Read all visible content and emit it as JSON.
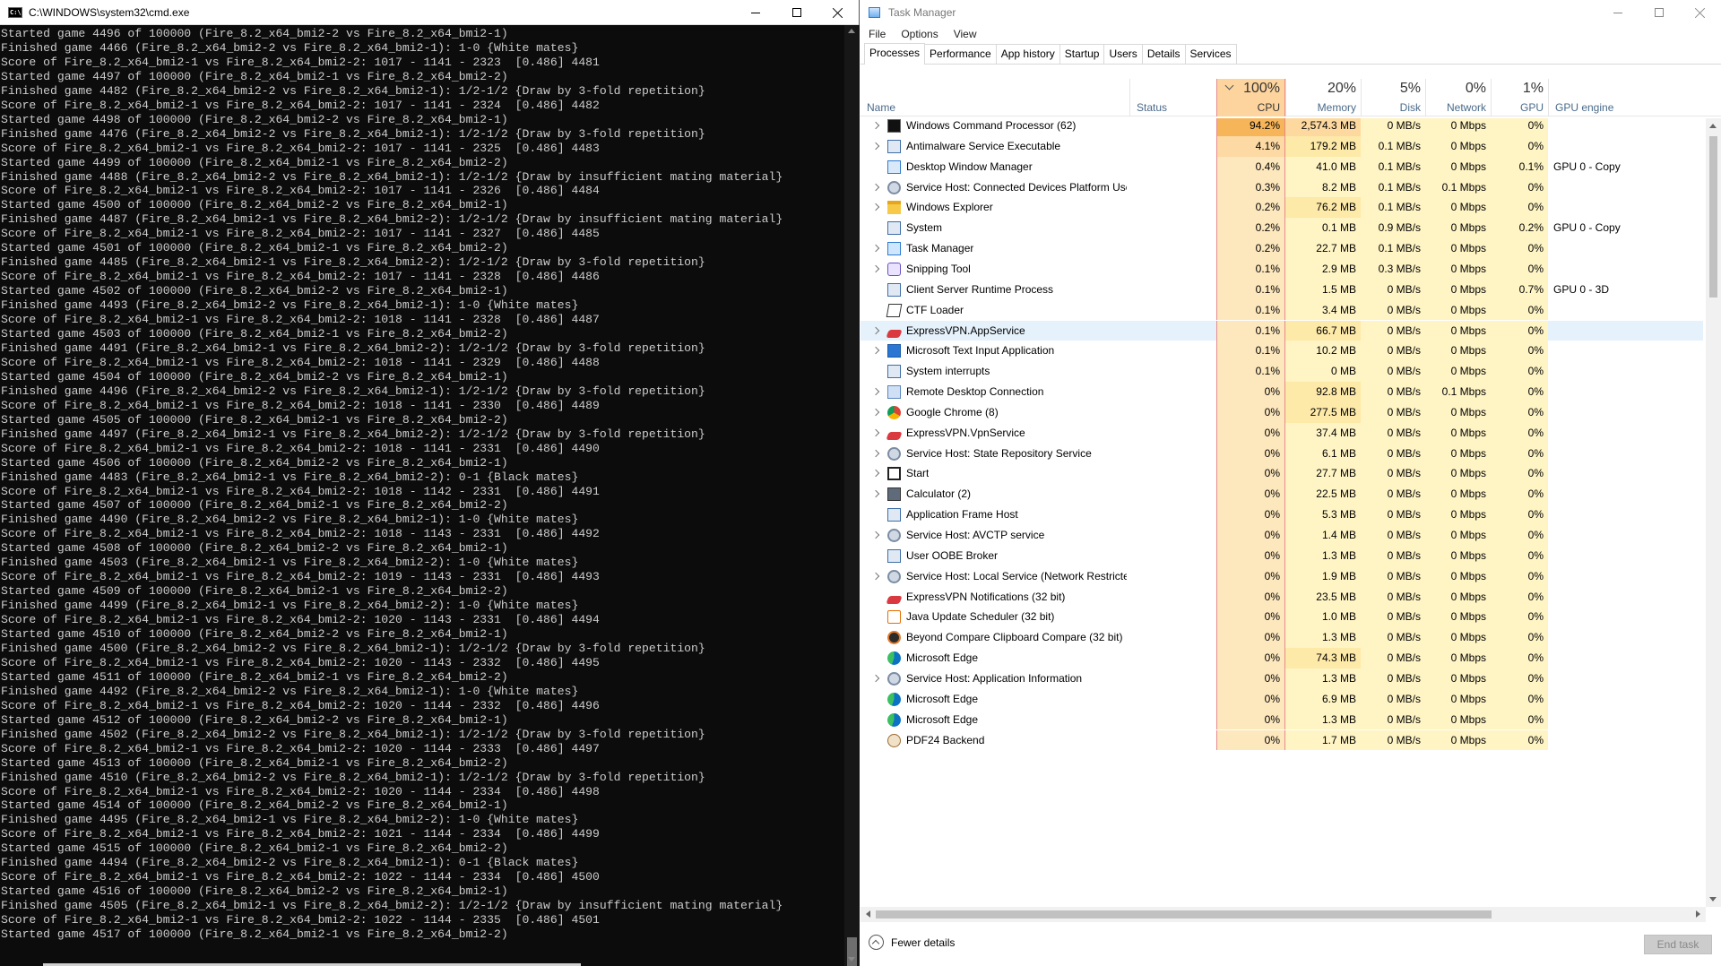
{
  "cmd": {
    "title": "C:\\WINDOWS\\system32\\cmd.exe",
    "lines": [
      "Started game 4496 of 100000 (Fire_8.2_x64_bmi2-2 vs Fire_8.2_x64_bmi2-1)",
      "Finished game 4466 (Fire_8.2_x64_bmi2-2 vs Fire_8.2_x64_bmi2-1): 1-0 {White mates}",
      "Score of Fire_8.2_x64_bmi2-1 vs Fire_8.2_x64_bmi2-2: 1017 - 1141 - 2323  [0.486] 4481",
      "Started game 4497 of 100000 (Fire_8.2_x64_bmi2-1 vs Fire_8.2_x64_bmi2-2)",
      "Finished game 4482 (Fire_8.2_x64_bmi2-2 vs Fire_8.2_x64_bmi2-1): 1/2-1/2 {Draw by 3-fold repetition}",
      "Score of Fire_8.2_x64_bmi2-1 vs Fire_8.2_x64_bmi2-2: 1017 - 1141 - 2324  [0.486] 4482",
      "Started game 4498 of 100000 (Fire_8.2_x64_bmi2-2 vs Fire_8.2_x64_bmi2-1)",
      "Finished game 4476 (Fire_8.2_x64_bmi2-2 vs Fire_8.2_x64_bmi2-1): 1/2-1/2 {Draw by 3-fold repetition}",
      "Score of Fire_8.2_x64_bmi2-1 vs Fire_8.2_x64_bmi2-2: 1017 - 1141 - 2325  [0.486] 4483",
      "Started game 4499 of 100000 (Fire_8.2_x64_bmi2-1 vs Fire_8.2_x64_bmi2-2)",
      "Finished game 4488 (Fire_8.2_x64_bmi2-2 vs Fire_8.2_x64_bmi2-1): 1/2-1/2 {Draw by insufficient mating material}",
      "Score of Fire_8.2_x64_bmi2-1 vs Fire_8.2_x64_bmi2-2: 1017 - 1141 - 2326  [0.486] 4484",
      "Started game 4500 of 100000 (Fire_8.2_x64_bmi2-2 vs Fire_8.2_x64_bmi2-1)",
      "Finished game 4487 (Fire_8.2_x64_bmi2-1 vs Fire_8.2_x64_bmi2-2): 1/2-1/2 {Draw by insufficient mating material}",
      "Score of Fire_8.2_x64_bmi2-1 vs Fire_8.2_x64_bmi2-2: 1017 - 1141 - 2327  [0.486] 4485",
      "Started game 4501 of 100000 (Fire_8.2_x64_bmi2-1 vs Fire_8.2_x64_bmi2-2)",
      "Finished game 4485 (Fire_8.2_x64_bmi2-1 vs Fire_8.2_x64_bmi2-2): 1/2-1/2 {Draw by 3-fold repetition}",
      "Score of Fire_8.2_x64_bmi2-1 vs Fire_8.2_x64_bmi2-2: 1017 - 1141 - 2328  [0.486] 4486",
      "Started game 4502 of 100000 (Fire_8.2_x64_bmi2-2 vs Fire_8.2_x64_bmi2-1)",
      "Finished game 4493 (Fire_8.2_x64_bmi2-2 vs Fire_8.2_x64_bmi2-1): 1-0 {White mates}",
      "Score of Fire_8.2_x64_bmi2-1 vs Fire_8.2_x64_bmi2-2: 1018 - 1141 - 2328  [0.486] 4487",
      "Started game 4503 of 100000 (Fire_8.2_x64_bmi2-1 vs Fire_8.2_x64_bmi2-2)",
      "Finished game 4491 (Fire_8.2_x64_bmi2-1 vs Fire_8.2_x64_bmi2-2): 1/2-1/2 {Draw by 3-fold repetition}",
      "Score of Fire_8.2_x64_bmi2-1 vs Fire_8.2_x64_bmi2-2: 1018 - 1141 - 2329  [0.486] 4488",
      "Started game 4504 of 100000 (Fire_8.2_x64_bmi2-2 vs Fire_8.2_x64_bmi2-1)",
      "Finished game 4496 (Fire_8.2_x64_bmi2-2 vs Fire_8.2_x64_bmi2-1): 1/2-1/2 {Draw by 3-fold repetition}",
      "Score of Fire_8.2_x64_bmi2-1 vs Fire_8.2_x64_bmi2-2: 1018 - 1141 - 2330  [0.486] 4489",
      "Started game 4505 of 100000 (Fire_8.2_x64_bmi2-1 vs Fire_8.2_x64_bmi2-2)",
      "Finished game 4497 (Fire_8.2_x64_bmi2-1 vs Fire_8.2_x64_bmi2-2): 1/2-1/2 {Draw by 3-fold repetition}",
      "Score of Fire_8.2_x64_bmi2-1 vs Fire_8.2_x64_bmi2-2: 1018 - 1141 - 2331  [0.486] 4490",
      "Started game 4506 of 100000 (Fire_8.2_x64_bmi2-2 vs Fire_8.2_x64_bmi2-1)",
      "Finished game 4483 (Fire_8.2_x64_bmi2-1 vs Fire_8.2_x64_bmi2-2): 0-1 {Black mates}",
      "Score of Fire_8.2_x64_bmi2-1 vs Fire_8.2_x64_bmi2-2: 1018 - 1142 - 2331  [0.486] 4491",
      "Started game 4507 of 100000 (Fire_8.2_x64_bmi2-1 vs Fire_8.2_x64_bmi2-2)",
      "Finished game 4490 (Fire_8.2_x64_bmi2-2 vs Fire_8.2_x64_bmi2-1): 1-0 {White mates}",
      "Score of Fire_8.2_x64_bmi2-1 vs Fire_8.2_x64_bmi2-2: 1018 - 1143 - 2331  [0.486] 4492",
      "Started game 4508 of 100000 (Fire_8.2_x64_bmi2-2 vs Fire_8.2_x64_bmi2-1)",
      "Finished game 4503 (Fire_8.2_x64_bmi2-1 vs Fire_8.2_x64_bmi2-2): 1-0 {White mates}",
      "Score of Fire_8.2_x64_bmi2-1 vs Fire_8.2_x64_bmi2-2: 1019 - 1143 - 2331  [0.486] 4493",
      "Started game 4509 of 100000 (Fire_8.2_x64_bmi2-1 vs Fire_8.2_x64_bmi2-2)",
      "Finished game 4499 (Fire_8.2_x64_bmi2-1 vs Fire_8.2_x64_bmi2-2): 1-0 {White mates}",
      "Score of Fire_8.2_x64_bmi2-1 vs Fire_8.2_x64_bmi2-2: 1020 - 1143 - 2331  [0.486] 4494",
      "Started game 4510 of 100000 (Fire_8.2_x64_bmi2-2 vs Fire_8.2_x64_bmi2-1)",
      "Finished game 4500 (Fire_8.2_x64_bmi2-2 vs Fire_8.2_x64_bmi2-1): 1/2-1/2 {Draw by 3-fold repetition}",
      "Score of Fire_8.2_x64_bmi2-1 vs Fire_8.2_x64_bmi2-2: 1020 - 1143 - 2332  [0.486] 4495",
      "Started game 4511 of 100000 (Fire_8.2_x64_bmi2-1 vs Fire_8.2_x64_bmi2-2)",
      "Finished game 4492 (Fire_8.2_x64_bmi2-2 vs Fire_8.2_x64_bmi2-1): 1-0 {White mates}",
      "Score of Fire_8.2_x64_bmi2-1 vs Fire_8.2_x64_bmi2-2: 1020 - 1144 - 2332  [0.486] 4496",
      "Started game 4512 of 100000 (Fire_8.2_x64_bmi2-2 vs Fire_8.2_x64_bmi2-1)",
      "Finished game 4502 (Fire_8.2_x64_bmi2-2 vs Fire_8.2_x64_bmi2-1): 1/2-1/2 {Draw by 3-fold repetition}",
      "Score of Fire_8.2_x64_bmi2-1 vs Fire_8.2_x64_bmi2-2: 1020 - 1144 - 2333  [0.486] 4497",
      "Started game 4513 of 100000 (Fire_8.2_x64_bmi2-1 vs Fire_8.2_x64_bmi2-2)",
      "Finished game 4510 (Fire_8.2_x64_bmi2-2 vs Fire_8.2_x64_bmi2-1): 1/2-1/2 {Draw by 3-fold repetition}",
      "Score of Fire_8.2_x64_bmi2-1 vs Fire_8.2_x64_bmi2-2: 1020 - 1144 - 2334  [0.486] 4498",
      "Started game 4514 of 100000 (Fire_8.2_x64_bmi2-2 vs Fire_8.2_x64_bmi2-1)",
      "Finished game 4495 (Fire_8.2_x64_bmi2-1 vs Fire_8.2_x64_bmi2-2): 1-0 {White mates}",
      "Score of Fire_8.2_x64_bmi2-1 vs Fire_8.2_x64_bmi2-2: 1021 - 1144 - 2334  [0.486] 4499",
      "Started game 4515 of 100000 (Fire_8.2_x64_bmi2-1 vs Fire_8.2_x64_bmi2-2)",
      "Finished game 4494 (Fire_8.2_x64_bmi2-2 vs Fire_8.2_x64_bmi2-1): 0-1 {Black mates}",
      "Score of Fire_8.2_x64_bmi2-1 vs Fire_8.2_x64_bmi2-2: 1022 - 1144 - 2334  [0.486] 4500",
      "Started game 4516 of 100000 (Fire_8.2_x64_bmi2-2 vs Fire_8.2_x64_bmi2-1)",
      "Finished game 4505 (Fire_8.2_x64_bmi2-1 vs Fire_8.2_x64_bmi2-2): 1/2-1/2 {Draw by insufficient mating material}",
      "Score of Fire_8.2_x64_bmi2-1 vs Fire_8.2_x64_bmi2-2: 1022 - 1144 - 2335  [0.486] 4501",
      "Started game 4517 of 100000 (Fire_8.2_x64_bmi2-1 vs Fire_8.2_x64_bmi2-2)"
    ]
  },
  "taskmanager": {
    "title": "Task Manager",
    "menu": [
      "File",
      "Options",
      "View"
    ],
    "tabs": [
      "Processes",
      "Performance",
      "App history",
      "Startup",
      "Users",
      "Details",
      "Services"
    ],
    "active_tab": "Processes",
    "columns": {
      "name": "Name",
      "status": "Status",
      "cpu": {
        "pct": "100%",
        "label": "CPU"
      },
      "memory": {
        "pct": "20%",
        "label": "Memory"
      },
      "disk": {
        "pct": "5%",
        "label": "Disk"
      },
      "network": {
        "pct": "0%",
        "label": "Network"
      },
      "gpu": {
        "pct": "1%",
        "label": "GPU"
      },
      "gpu_engine": "GPU engine"
    },
    "processes": [
      {
        "name": "Windows Command Processor (62)",
        "icon": "cmd-icon",
        "expand": true,
        "cpu": "94.2%",
        "mem": "2,574.3 MB",
        "disk": "0 MB/s",
        "net": "0 Mbps",
        "gpu": "0%",
        "engine": ""
      },
      {
        "name": "Antimalware Service Executable",
        "icon": "shield-icon",
        "expand": true,
        "cpu": "4.1%",
        "mem": "179.2 MB",
        "disk": "0.1 MB/s",
        "net": "0 Mbps",
        "gpu": "0%",
        "engine": ""
      },
      {
        "name": "Desktop Window Manager",
        "icon": "dwm-icon",
        "expand": false,
        "cpu": "0.4%",
        "mem": "41.0 MB",
        "disk": "0.1 MB/s",
        "net": "0 Mbps",
        "gpu": "0.1%",
        "engine": "GPU 0 - Copy"
      },
      {
        "name": "Service Host: Connected Devices Platform User S...",
        "icon": "gear-icon",
        "expand": true,
        "cpu": "0.3%",
        "mem": "8.2 MB",
        "disk": "0.1 MB/s",
        "net": "0.1 Mbps",
        "gpu": "0%",
        "engine": ""
      },
      {
        "name": "Windows Explorer",
        "icon": "folder-icon",
        "expand": true,
        "cpu": "0.2%",
        "mem": "76.2 MB",
        "disk": "0.1 MB/s",
        "net": "0 Mbps",
        "gpu": "0%",
        "engine": ""
      },
      {
        "name": "System",
        "icon": "system-icon",
        "expand": false,
        "cpu": "0.2%",
        "mem": "0.1 MB",
        "disk": "0.9 MB/s",
        "net": "0 Mbps",
        "gpu": "0.2%",
        "engine": "GPU 0 - Copy"
      },
      {
        "name": "Task Manager",
        "icon": "taskmanager-icon",
        "expand": true,
        "cpu": "0.2%",
        "mem": "22.7 MB",
        "disk": "0.1 MB/s",
        "net": "0 Mbps",
        "gpu": "0%",
        "engine": ""
      },
      {
        "name": "Snipping Tool",
        "icon": "snipping-icon",
        "expand": true,
        "cpu": "0.1%",
        "mem": "2.9 MB",
        "disk": "0.3 MB/s",
        "net": "0 Mbps",
        "gpu": "0%",
        "engine": ""
      },
      {
        "name": "Client Server Runtime Process",
        "icon": "system-icon",
        "expand": false,
        "cpu": "0.1%",
        "mem": "1.5 MB",
        "disk": "0 MB/s",
        "net": "0 Mbps",
        "gpu": "0.7%",
        "engine": "GPU 0 - 3D"
      },
      {
        "name": "CTF Loader",
        "icon": "ctf-icon",
        "expand": false,
        "cpu": "0.1%",
        "mem": "3.4 MB",
        "disk": "0 MB/s",
        "net": "0 Mbps",
        "gpu": "0%",
        "engine": ""
      },
      {
        "name": "ExpressVPN.AppService",
        "icon": "expressvpn-icon",
        "expand": true,
        "cpu": "0.1%",
        "mem": "66.7 MB",
        "disk": "0 MB/s",
        "net": "0 Mbps",
        "gpu": "0%",
        "engine": "",
        "selected": true
      },
      {
        "name": "Microsoft Text Input Application",
        "icon": "text-input-icon",
        "expand": true,
        "cpu": "0.1%",
        "mem": "10.2 MB",
        "disk": "0 MB/s",
        "net": "0 Mbps",
        "gpu": "0%",
        "engine": ""
      },
      {
        "name": "System interrupts",
        "icon": "system-icon",
        "expand": false,
        "cpu": "0.1%",
        "mem": "0 MB",
        "disk": "0 MB/s",
        "net": "0 Mbps",
        "gpu": "0%",
        "engine": ""
      },
      {
        "name": "Remote Desktop Connection",
        "icon": "remote-desktop-icon",
        "expand": true,
        "cpu": "0%",
        "mem": "92.8 MB",
        "disk": "0 MB/s",
        "net": "0.1 Mbps",
        "gpu": "0%",
        "engine": ""
      },
      {
        "name": "Google Chrome (8)",
        "icon": "chrome-icon",
        "expand": true,
        "cpu": "0%",
        "mem": "277.5 MB",
        "disk": "0 MB/s",
        "net": "0 Mbps",
        "gpu": "0%",
        "engine": ""
      },
      {
        "name": "ExpressVPN.VpnService",
        "icon": "expressvpn-icon",
        "expand": true,
        "cpu": "0%",
        "mem": "37.4 MB",
        "disk": "0 MB/s",
        "net": "0 Mbps",
        "gpu": "0%",
        "engine": ""
      },
      {
        "name": "Service Host: State Repository Service",
        "icon": "gear-icon",
        "expand": true,
        "cpu": "0%",
        "mem": "6.1 MB",
        "disk": "0 MB/s",
        "net": "0 Mbps",
        "gpu": "0%",
        "engine": ""
      },
      {
        "name": "Start",
        "icon": "start-icon",
        "expand": true,
        "cpu": "0%",
        "mem": "27.7 MB",
        "disk": "0 MB/s",
        "net": "0 Mbps",
        "gpu": "0%",
        "engine": ""
      },
      {
        "name": "Calculator (2)",
        "icon": "calculator-icon",
        "expand": true,
        "cpu": "0%",
        "mem": "22.5 MB",
        "disk": "0 MB/s",
        "net": "0 Mbps",
        "gpu": "0%",
        "engine": ""
      },
      {
        "name": "Application Frame Host",
        "icon": "system-icon",
        "expand": false,
        "cpu": "0%",
        "mem": "5.3 MB",
        "disk": "0 MB/s",
        "net": "0 Mbps",
        "gpu": "0%",
        "engine": ""
      },
      {
        "name": "Service Host: AVCTP service",
        "icon": "gear-icon",
        "expand": true,
        "cpu": "0%",
        "mem": "1.4 MB",
        "disk": "0 MB/s",
        "net": "0 Mbps",
        "gpu": "0%",
        "engine": ""
      },
      {
        "name": "User OOBE Broker",
        "icon": "system-icon",
        "expand": false,
        "cpu": "0%",
        "mem": "1.3 MB",
        "disk": "0 MB/s",
        "net": "0 Mbps",
        "gpu": "0%",
        "engine": ""
      },
      {
        "name": "Service Host: Local Service (Network Restricted)",
        "icon": "gear-icon",
        "expand": true,
        "cpu": "0%",
        "mem": "1.9 MB",
        "disk": "0 MB/s",
        "net": "0 Mbps",
        "gpu": "0%",
        "engine": ""
      },
      {
        "name": "ExpressVPN Notifications (32 bit)",
        "icon": "expressvpn-icon",
        "expand": false,
        "cpu": "0%",
        "mem": "23.5 MB",
        "disk": "0 MB/s",
        "net": "0 Mbps",
        "gpu": "0%",
        "engine": ""
      },
      {
        "name": "Java Update Scheduler (32 bit)",
        "icon": "java-icon",
        "expand": false,
        "cpu": "0%",
        "mem": "1.0 MB",
        "disk": "0 MB/s",
        "net": "0 Mbps",
        "gpu": "0%",
        "engine": ""
      },
      {
        "name": "Beyond Compare Clipboard Compare (32 bit)",
        "icon": "beyond-compare-icon",
        "expand": false,
        "cpu": "0%",
        "mem": "1.3 MB",
        "disk": "0 MB/s",
        "net": "0 Mbps",
        "gpu": "0%",
        "engine": ""
      },
      {
        "name": "Microsoft Edge",
        "icon": "edge-icon",
        "expand": false,
        "cpu": "0%",
        "mem": "74.3 MB",
        "disk": "0 MB/s",
        "net": "0 Mbps",
        "gpu": "0%",
        "engine": ""
      },
      {
        "name": "Service Host: Application Information",
        "icon": "gear-icon",
        "expand": true,
        "cpu": "0%",
        "mem": "1.3 MB",
        "disk": "0 MB/s",
        "net": "0 Mbps",
        "gpu": "0%",
        "engine": ""
      },
      {
        "name": "Microsoft Edge",
        "icon": "edge-icon",
        "expand": false,
        "cpu": "0%",
        "mem": "6.9 MB",
        "disk": "0 MB/s",
        "net": "0 Mbps",
        "gpu": "0%",
        "engine": ""
      },
      {
        "name": "Microsoft Edge",
        "icon": "edge-icon",
        "expand": false,
        "cpu": "0%",
        "mem": "1.3 MB",
        "disk": "0 MB/s",
        "net": "0 Mbps",
        "gpu": "0%",
        "engine": ""
      },
      {
        "name": "PDF24 Backend",
        "icon": "pdf24-icon",
        "expand": false,
        "cpu": "0%",
        "mem": "1.7 MB",
        "disk": "0 MB/s",
        "net": "0 Mbps",
        "gpu": "0%",
        "engine": ""
      }
    ],
    "footer": {
      "fewer_details": "Fewer details",
      "end_task": "End task"
    }
  }
}
